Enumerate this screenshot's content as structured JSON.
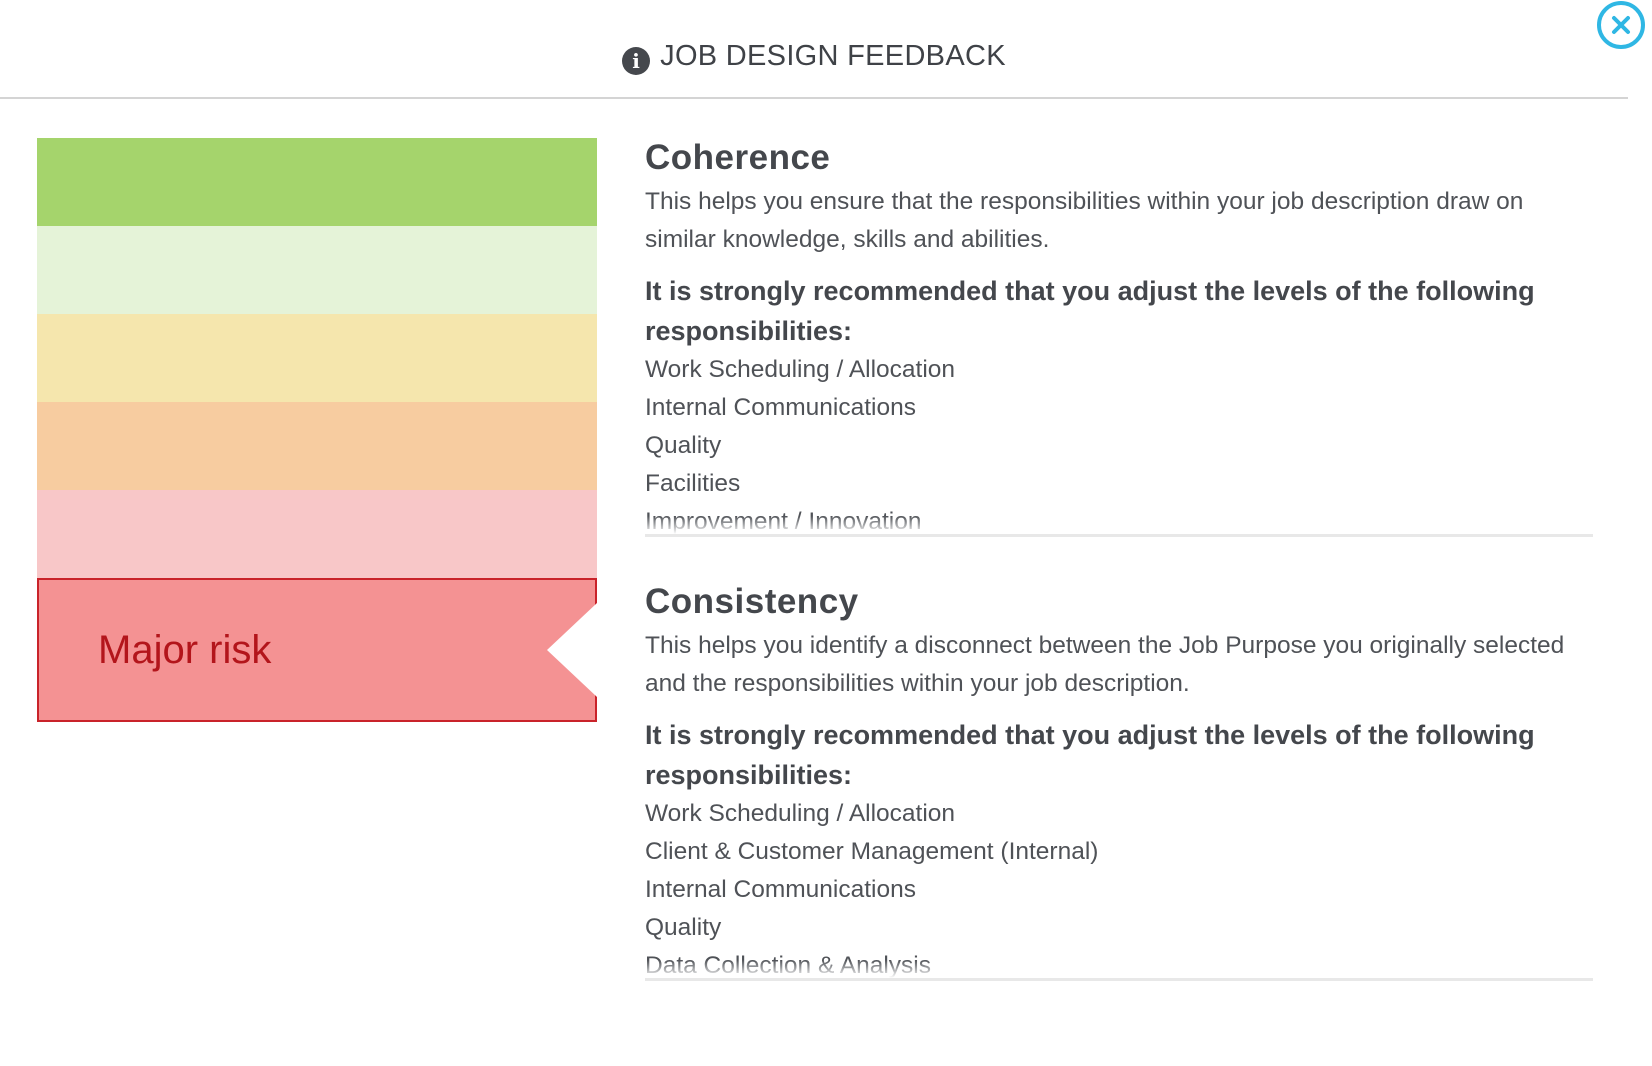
{
  "header": {
    "title": "JOB DESIGN FEEDBACK",
    "info_icon": "info-icon",
    "close_icon": "close-icon",
    "accent_color": "#2fb7e4"
  },
  "risk_scale": {
    "selected_label": "Major risk",
    "band_colors": [
      "#a5d46c",
      "#e5f3d8",
      "#f5e6ad",
      "#f7cca0",
      "#f8c7c8",
      "#f49293"
    ],
    "selected_label_color": "#b3151b"
  },
  "sections": [
    {
      "title": "Coherence",
      "description": "This helps you ensure that the responsibilities within your job description draw on similar knowledge, skills and abilities.",
      "recommendation": "It is strongly recommended that you adjust the levels of the following responsibilities:",
      "responsibilities": [
        "Work Scheduling / Allocation",
        "Internal Communications",
        "Quality",
        "Facilities",
        "Improvement / Innovation"
      ]
    },
    {
      "title": "Consistency",
      "description": "This helps you identify a disconnect between the Job Purpose you originally selected and the responsibilities within your job description.",
      "recommendation": "It is strongly recommended that you adjust the levels of the following responsibilities:",
      "responsibilities": [
        "Work Scheduling / Allocation",
        "Client & Customer Management (Internal)",
        "Internal Communications",
        "Quality",
        "Data Collection & Analysis"
      ]
    }
  ]
}
